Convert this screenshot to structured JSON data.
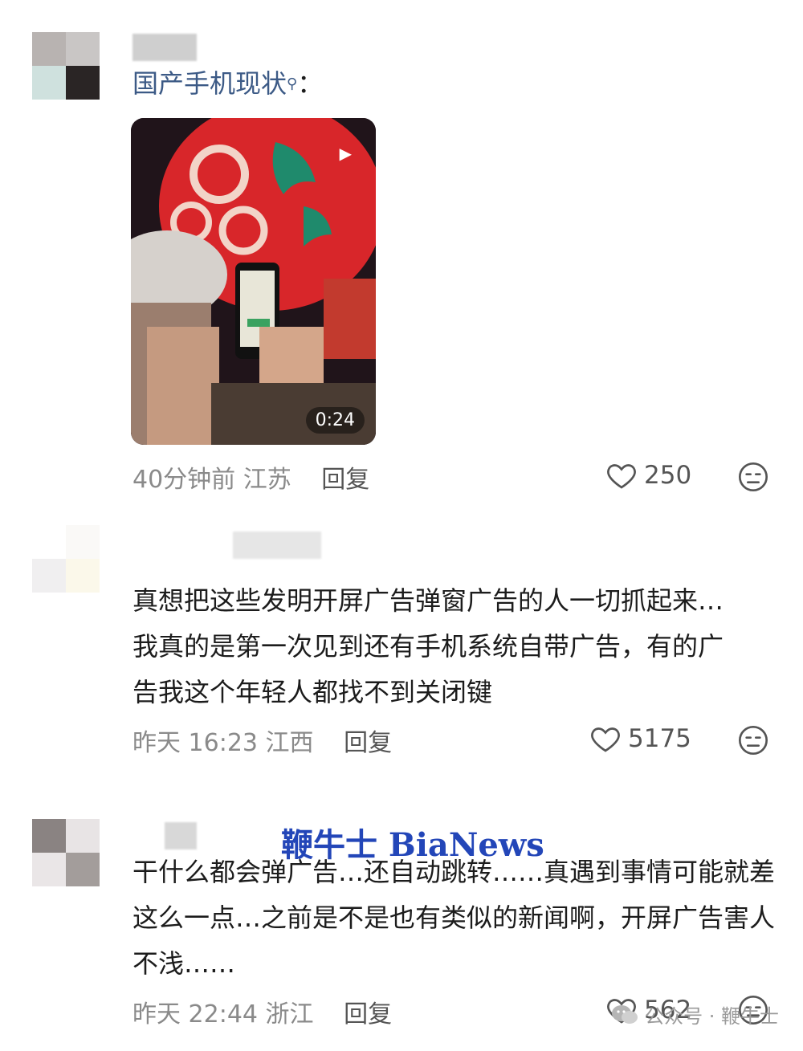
{
  "comments": [
    {
      "text_prefix": "国产手机现状",
      "text_suffix": "：",
      "video_duration": "0:24",
      "time": "40分钟前",
      "location": "江苏",
      "reply": "回复",
      "likes": "250"
    },
    {
      "text": "真想把这些发明开屏广告弹窗广告的人一切抓起来…我真的是第一次见到还有手机系统自带广告，有的广告我这个年轻人都找不到关闭键",
      "time": "昨天 16:23",
      "location": "江西",
      "reply": "回复",
      "likes": "5175"
    },
    {
      "text": "干什么都会弹广告…还自动跳转……真遇到事情可能就差这么一点…之前是不是也有类似的新闻啊，开屏广告害人不浅……",
      "time": "昨天 22:44",
      "location": "浙江",
      "reply": "回复",
      "likes": "562"
    }
  ],
  "watermark": {
    "center": "鞭牛士 BiaNews",
    "bottom": "公众号 · 鞭牛士"
  },
  "colors": {
    "mention": "#3c5a86",
    "watermark": "#2346b8"
  }
}
